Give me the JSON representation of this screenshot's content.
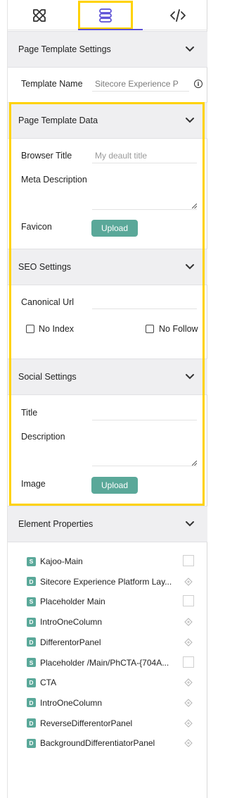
{
  "tabs": [
    {
      "icon": "tools-icon"
    },
    {
      "icon": "layers-icon",
      "active": true
    },
    {
      "icon": "code-icon"
    }
  ],
  "sections": {
    "page_template_settings": {
      "title": "Page Template Settings",
      "template_name_label": "Template Name",
      "template_name_value": "Sitecore Experience P"
    },
    "page_template_data": {
      "title": "Page Template Data",
      "browser_title_label": "Browser Title",
      "browser_title_placeholder": "My deault title",
      "meta_description_label": "Meta Description",
      "favicon_label": "Favicon",
      "upload_label": "Upload"
    },
    "seo_settings": {
      "title": "SEO Settings",
      "canonical_url_label": "Canonical Url",
      "no_index_label": "No Index",
      "no_follow_label": "No Follow"
    },
    "social_settings": {
      "title": "Social Settings",
      "title_label": "Title",
      "description_label": "Description",
      "image_label": "Image",
      "upload_label": "Upload"
    },
    "element_properties": {
      "title": "Element Properties",
      "items": [
        {
          "badge": "S",
          "label": "Kajoo-Main",
          "marker": "square"
        },
        {
          "badge": "D",
          "label": "Sitecore Experience Platform Lay...",
          "marker": "diamond"
        },
        {
          "badge": "S",
          "label": "Placeholder Main",
          "marker": "square"
        },
        {
          "badge": "D",
          "label": "IntroOneColumn",
          "marker": "diamond"
        },
        {
          "badge": "D",
          "label": "DifferentorPanel",
          "marker": "diamond"
        },
        {
          "badge": "S",
          "label": "Placeholder /Main/PhCTA-{704A...",
          "marker": "square"
        },
        {
          "badge": "D",
          "label": "CTA",
          "marker": "diamond"
        },
        {
          "badge": "D",
          "label": "IntroOneColumn",
          "marker": "diamond"
        },
        {
          "badge": "D",
          "label": "ReverseDifferentorPanel",
          "marker": "diamond"
        },
        {
          "badge": "D",
          "label": "BackgroundDifferentiatorPanel",
          "marker": "diamond"
        }
      ]
    }
  },
  "colors": {
    "accent_teal": "#5aa899",
    "highlight_yellow": "#ffd200",
    "tab_active": "#5b4fd6",
    "section_bg": "#efeff1"
  }
}
